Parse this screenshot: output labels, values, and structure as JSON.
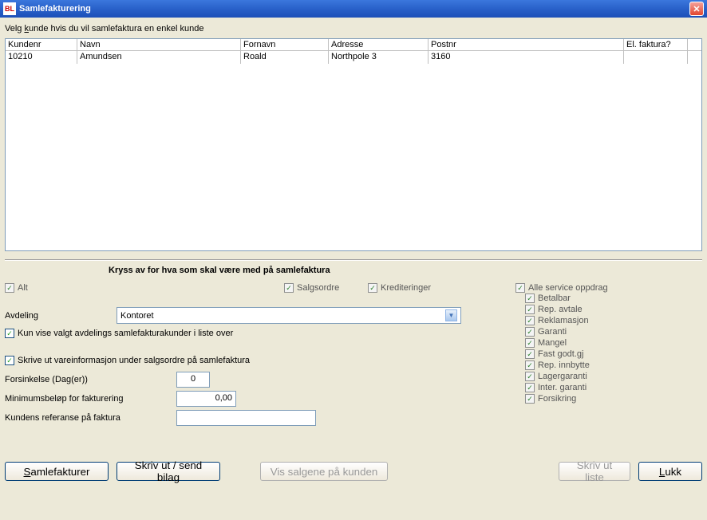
{
  "window": {
    "title": "Samlefakturering",
    "app_icon_text": "BL"
  },
  "instruction": "Velg kunde hvis du vil samlefaktura en enkel kunde",
  "grid": {
    "columns": [
      "Kundenr",
      "Navn",
      "Fornavn",
      "Adresse",
      "Postnr",
      "El. faktura?"
    ],
    "rows": [
      {
        "kundenr": "10210",
        "navn": "Amundsen",
        "fornavn": "Roald",
        "adresse": "Northpole 3",
        "postnr": "3160",
        "elfaktura": ""
      }
    ]
  },
  "options": {
    "section_title": "Kryss av for hva som skal være med på samlefaktura",
    "alt": {
      "label": "Alt",
      "checked": true
    },
    "salgsordre": {
      "label": "Salgsordre",
      "checked": true
    },
    "krediteringer": {
      "label": "Krediteringer",
      "checked": true
    },
    "alle_service": {
      "label": "Alle service oppdrag",
      "checked": true
    },
    "service_items": [
      {
        "label": "Betalbar",
        "checked": true
      },
      {
        "label": "Rep. avtale",
        "checked": true
      },
      {
        "label": "Reklamasjon",
        "checked": true
      },
      {
        "label": "Garanti",
        "checked": true
      },
      {
        "label": "Mangel",
        "checked": true
      },
      {
        "label": "Fast godt.gj",
        "checked": true
      },
      {
        "label": "Rep. innbytte",
        "checked": true
      },
      {
        "label": "Lagergaranti",
        "checked": true
      },
      {
        "label": "Inter. garanti",
        "checked": true
      },
      {
        "label": "Forsikring",
        "checked": true
      }
    ],
    "avdeling_label": "Avdeling",
    "avdeling_value": "Kontoret",
    "kun_vise": {
      "label": "Kun vise valgt avdelings samlefakturakunder i liste over",
      "checked": true
    },
    "skrive_ut_varinfo": {
      "label": "Skrive ut vareinformasjon under salgsordre på samlefaktura",
      "checked": true
    },
    "forsinkelse_label": "Forsinkelse (Dag(er))",
    "forsinkelse_value": "0",
    "minbelop_label": "Minimumsbeløp for fakturering",
    "minbelop_value": "0,00",
    "kundens_ref_label": "Kundens referanse på faktura",
    "kundens_ref_value": ""
  },
  "buttons": {
    "samlefakturer": "Samlefakturer",
    "skriv_ut_send": "Skriv ut / send bilag",
    "vis_salgene": "Vis salgene på kunden",
    "skriv_ut_liste": "Skriv ut liste",
    "lukk": "Lukk"
  }
}
